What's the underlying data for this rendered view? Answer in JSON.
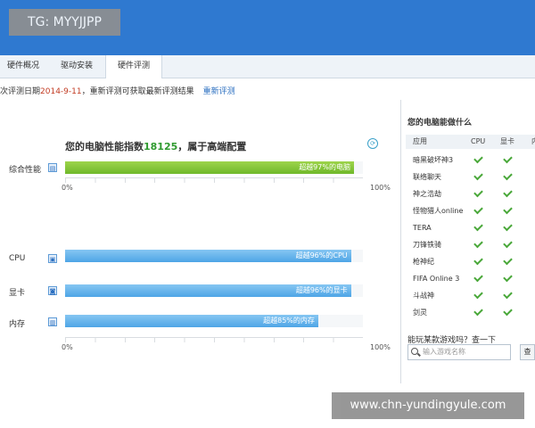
{
  "watermark_top": "TG: MYYJJPP",
  "watermark_bottom": "www.chn-yundingyule.com",
  "tabs": [
    "硬件概况",
    "驱动安装",
    "硬件评测"
  ],
  "info": {
    "prefix": "次评测日期",
    "date": "2014-9-11",
    "suffix": "，重新评测可获取最新评测结果",
    "retest_link": "重新评测"
  },
  "score": {
    "title_prefix": "您的电脑性能指数",
    "value": "18125",
    "title_suffix": "，属于高端配置"
  },
  "overall": {
    "label": "综合性能",
    "percent": 97,
    "bar_text": "超越97%的电脑"
  },
  "components": [
    {
      "label": "CPU",
      "percent": 96,
      "bar_text": "超越96%的CPU"
    },
    {
      "label": "显卡",
      "percent": 96,
      "bar_text": "超越96%的显卡"
    },
    {
      "label": "内存",
      "percent": 85,
      "bar_text": "超越85%的内存"
    }
  ],
  "axis": {
    "min": "0%",
    "max": "100%"
  },
  "sidebar": {
    "title": "您的电脑能做什么",
    "headers": [
      "应用",
      "CPU",
      "显卡",
      "内"
    ],
    "games": [
      "暗黑破坏神3",
      "联络聊天",
      "神之浩劫",
      "怪物猎人online",
      "TERA",
      "刀锋铁骑",
      "枪神纪",
      "FIFA Online 3",
      "斗战神",
      "剑灵"
    ],
    "ask": "能玩某款游戏吗？查一下",
    "search_placeholder": "输入游戏名称",
    "search_button": "查"
  },
  "colors": {
    "overall_bar": "#7cc231",
    "component_bar": "#5fb0ea",
    "check": "#4aa83a",
    "date": "#c23b22",
    "link": "#2b6fc0"
  }
}
